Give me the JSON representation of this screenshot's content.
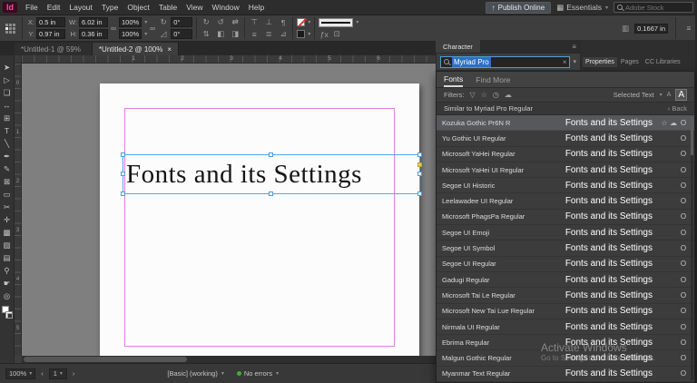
{
  "menubar": {
    "logo": "Id",
    "items": [
      "File",
      "Edit",
      "Layout",
      "Type",
      "Object",
      "Table",
      "View",
      "Window",
      "Help"
    ],
    "publish_button": "Publish Online",
    "workspace": "Essentials",
    "search_placeholder": "Adobe Stock"
  },
  "icons": {
    "hamburger": "≡",
    "dropdown": "▾",
    "upload": "↑",
    "workspace_grid": "▦",
    "chain": "∞",
    "star": "☆",
    "clock": "◷",
    "cloud": "☁",
    "funnel": "▽",
    "back_arrow": "‹",
    "close": "×",
    "nav_left": "‹",
    "nav_right": "›"
  },
  "control_bar": {
    "x_label": "X:",
    "x_value": "0.5 in",
    "y_label": "Y:",
    "y_value": "0.97 in",
    "w_label": "W:",
    "w_value": "6.02 in",
    "h_label": "H:",
    "h_value": "0.36 in",
    "scale_x": "100%",
    "scale_y": "100%",
    "rotation": "0°",
    "shear": "0°",
    "gutter_value": "0.1667 in"
  },
  "doc_tabs": [
    {
      "label": "*Untitled-1 @ 59%",
      "close": "",
      "active": false
    },
    {
      "label": "*Untitled-2 @ 100%",
      "close": "×",
      "active": true
    }
  ],
  "toolbar_tools": [
    {
      "name": "selection-tool",
      "glyph": "➤"
    },
    {
      "name": "direct-selection-tool",
      "glyph": "▷"
    },
    {
      "name": "page-tool",
      "glyph": "❏"
    },
    {
      "name": "gap-tool",
      "glyph": "↔"
    },
    {
      "name": "content-collector-tool",
      "glyph": "⊞"
    },
    {
      "name": "type-tool",
      "glyph": "T"
    },
    {
      "name": "line-tool",
      "glyph": "╲"
    },
    {
      "name": "pen-tool",
      "glyph": "✒"
    },
    {
      "name": "pencil-tool",
      "glyph": "✎"
    },
    {
      "name": "rectangle-frame-tool",
      "glyph": "⊠"
    },
    {
      "name": "rectangle-tool",
      "glyph": "▭"
    },
    {
      "name": "scissors-tool",
      "glyph": "✂"
    },
    {
      "name": "free-transform-tool",
      "glyph": "✛"
    },
    {
      "name": "gradient-tool",
      "glyph": "▩"
    },
    {
      "name": "gradient-feather-tool",
      "glyph": "▨"
    },
    {
      "name": "note-tool",
      "glyph": "▤"
    },
    {
      "name": "eyedropper-tool",
      "glyph": "⚲"
    },
    {
      "name": "hand-tool",
      "glyph": "☛"
    },
    {
      "name": "zoom-tool",
      "glyph": "◎"
    }
  ],
  "hruler_numbers": [
    "1",
    "2",
    "3",
    "4",
    "5",
    "6"
  ],
  "vruler_numbers": [
    "0",
    "1",
    "2",
    "3",
    "4",
    "5"
  ],
  "canvas": {
    "frame_text": "Fonts and its Settings"
  },
  "character_panel": {
    "title": "Character",
    "search_value": "Myriad Pro",
    "tabs": [
      {
        "label": "Fonts",
        "active": true
      },
      {
        "label": "Find More",
        "active": false
      }
    ],
    "filters_label": "Filters:",
    "selected_text_label": "Selected Text",
    "sample_small": "A",
    "sample_large": "A",
    "similar_label": "Similar to Myriad Pro Regular",
    "back_label": "Back",
    "fonts": [
      {
        "name": "Kozuka Gothic Pr6N R",
        "preview": "Fonts and its Settings",
        "badge": "O",
        "star": "☆",
        "cloud": "☁",
        "selected": true
      },
      {
        "name": "Yu Gothic UI Regular",
        "preview": "Fonts and its Settings",
        "badge": "O",
        "star": "",
        "cloud": "",
        "selected": false
      },
      {
        "name": "Microsoft YaHei Regular",
        "preview": "Fonts and its Settings",
        "badge": "O",
        "star": "",
        "cloud": "",
        "selected": false
      },
      {
        "name": "Microsoft YaHei UI Regular",
        "preview": "Fonts and its Settings",
        "badge": "O",
        "star": "",
        "cloud": "",
        "selected": false
      },
      {
        "name": "Segoe UI Historic",
        "preview": "Fonts and its Settings",
        "badge": "O",
        "star": "",
        "cloud": "",
        "selected": false
      },
      {
        "name": "Leelawadee UI Regular",
        "preview": "Fonts and its Settings",
        "badge": "O",
        "star": "",
        "cloud": "",
        "selected": false
      },
      {
        "name": "Microsoft PhagsPa Regular",
        "preview": "Fonts and its Settings",
        "badge": "O",
        "star": "",
        "cloud": "",
        "selected": false
      },
      {
        "name": "Segoe UI Emoji",
        "preview": "Fonts and its Settings",
        "badge": "O",
        "star": "",
        "cloud": "",
        "selected": false
      },
      {
        "name": "Segoe UI Symbol",
        "preview": "Fonts and its Settings",
        "badge": "O",
        "star": "",
        "cloud": "",
        "selected": false
      },
      {
        "name": "Segoe UI Regular",
        "preview": "Fonts and its Settings",
        "badge": "O",
        "star": "",
        "cloud": "",
        "selected": false
      },
      {
        "name": "Gadugi Regular",
        "preview": "Fonts and its Settings",
        "badge": "O",
        "star": "",
        "cloud": "",
        "selected": false
      },
      {
        "name": "Microsoft Tai Le Regular",
        "preview": "Fonts and its Settings",
        "badge": "O",
        "star": "",
        "cloud": "",
        "selected": false
      },
      {
        "name": "Microsoft New Tai Lue Regular",
        "preview": "Fonts and its Settings",
        "badge": "O",
        "star": "",
        "cloud": "",
        "selected": false
      },
      {
        "name": "Nirmala UI Regular",
        "preview": "Fonts and its Settings",
        "badge": "O",
        "star": "",
        "cloud": "",
        "selected": false
      },
      {
        "name": "Ebrima Regular",
        "preview": "Fonts and its Settings",
        "badge": "O",
        "star": "",
        "cloud": "",
        "selected": false
      },
      {
        "name": "Malgun Gothic Regular",
        "preview": "Fonts and its Settings",
        "badge": "O",
        "star": "",
        "cloud": "",
        "selected": false
      },
      {
        "name": "Myanmar Text Regular",
        "preview": "Fonts and its Settings",
        "badge": "O",
        "star": "",
        "cloud": "",
        "selected": false
      }
    ]
  },
  "dock_tabs": [
    {
      "label": "Properties",
      "active": true
    },
    {
      "label": "Pages",
      "active": false
    },
    {
      "label": "CC Libraries",
      "active": false
    }
  ],
  "status_bar": {
    "zoom": "100%",
    "page": "1",
    "preflight": "[Basic] (working)",
    "errors": "No errors"
  },
  "watermark": {
    "line1": "Activate Windows",
    "line2": "Go to Settings to activate Windows."
  }
}
